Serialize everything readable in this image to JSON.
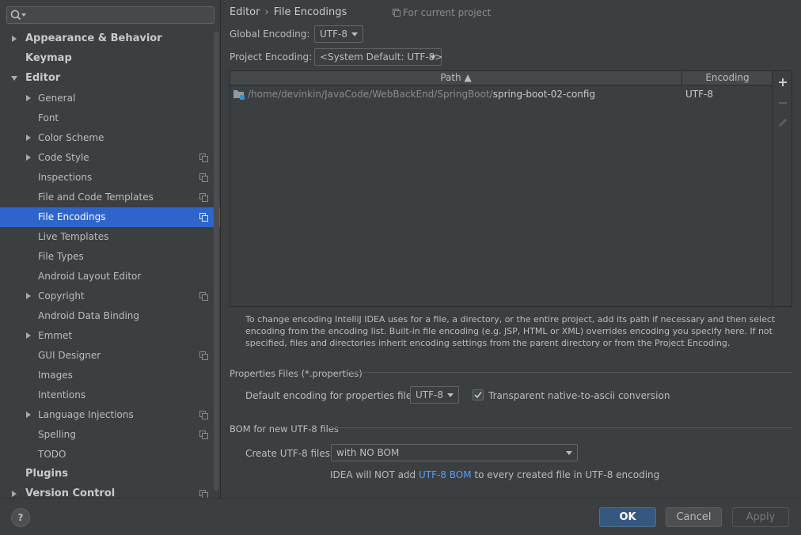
{
  "search": {
    "value": ""
  },
  "sidebar": {
    "items": [
      {
        "label": "Appearance & Behavior",
        "level": 0,
        "arrow": "right",
        "scope": false
      },
      {
        "label": "Keymap",
        "level": 0,
        "arrow": "none",
        "scope": false
      },
      {
        "label": "Editor",
        "level": 0,
        "arrow": "down",
        "scope": false
      },
      {
        "label": "General",
        "level": 1,
        "arrow": "right",
        "scope": false
      },
      {
        "label": "Font",
        "level": 1,
        "arrow": "none",
        "scope": false
      },
      {
        "label": "Color Scheme",
        "level": 1,
        "arrow": "right",
        "scope": false
      },
      {
        "label": "Code Style",
        "level": 1,
        "arrow": "right",
        "scope": true
      },
      {
        "label": "Inspections",
        "level": 1,
        "arrow": "none",
        "scope": true
      },
      {
        "label": "File and Code Templates",
        "level": 1,
        "arrow": "none",
        "scope": true
      },
      {
        "label": "File Encodings",
        "level": 1,
        "arrow": "none",
        "scope": true,
        "selected": true
      },
      {
        "label": "Live Templates",
        "level": 1,
        "arrow": "none",
        "scope": false
      },
      {
        "label": "File Types",
        "level": 1,
        "arrow": "none",
        "scope": false
      },
      {
        "label": "Android Layout Editor",
        "level": 1,
        "arrow": "none",
        "scope": false
      },
      {
        "label": "Copyright",
        "level": 1,
        "arrow": "right",
        "scope": true
      },
      {
        "label": "Android Data Binding",
        "level": 1,
        "arrow": "none",
        "scope": false
      },
      {
        "label": "Emmet",
        "level": 1,
        "arrow": "right",
        "scope": false
      },
      {
        "label": "GUI Designer",
        "level": 1,
        "arrow": "none",
        "scope": true
      },
      {
        "label": "Images",
        "level": 1,
        "arrow": "none",
        "scope": false
      },
      {
        "label": "Intentions",
        "level": 1,
        "arrow": "none",
        "scope": false
      },
      {
        "label": "Language Injections",
        "level": 1,
        "arrow": "right",
        "scope": true
      },
      {
        "label": "Spelling",
        "level": 1,
        "arrow": "none",
        "scope": true
      },
      {
        "label": "TODO",
        "level": 1,
        "arrow": "none",
        "scope": false
      },
      {
        "label": "Plugins",
        "level": 0,
        "arrow": "none",
        "scope": false
      },
      {
        "label": "Version Control",
        "level": 0,
        "arrow": "right",
        "scope": true
      }
    ]
  },
  "breadcrumb": {
    "parent": "Editor",
    "separator": "›",
    "current": "File Encodings"
  },
  "scope_note": "For current project",
  "global_encoding": {
    "label": "Global Encoding:",
    "value": "UTF-8"
  },
  "project_encoding": {
    "label": "Project Encoding:",
    "value": "<System Default: UTF-8>"
  },
  "table": {
    "col_path": "Path ▲",
    "col_encoding": "Encoding",
    "rows": [
      {
        "path_prefix": "/home/devinkin/JavaCode/WebBackEnd/SpringBoot/",
        "path_name": "spring-boot-02-config",
        "encoding": "UTF-8"
      }
    ]
  },
  "hint": "To change encoding IntelliJ IDEA uses for a file, a directory, or the entire project, add its path if necessary and then select encoding from the encoding list. Built-in file encoding (e.g. JSP, HTML or XML) overrides encoding you specify here. If not specified, files and directories inherit encoding settings from the parent directory or from the Project Encoding.",
  "properties": {
    "section_title": "Properties Files (*.properties)",
    "default_label": "Default encoding for properties files:",
    "default_value": "UTF-8",
    "ascii_label": "Transparent native-to-ascii conversion",
    "ascii_checked": true
  },
  "bom": {
    "section_title": "BOM for new UTF-8 files",
    "create_label": "Create UTF-8 files:",
    "create_value": "with NO BOM",
    "note_prefix": "IDEA will NOT add ",
    "note_link": "UTF-8 BOM",
    "note_suffix": " to every created file in UTF-8 encoding"
  },
  "buttons": {
    "help": "?",
    "ok": "OK",
    "cancel": "Cancel",
    "apply": "Apply"
  },
  "colors": {
    "accent": "#2f65ca",
    "ok_button": "#365880",
    "link": "#589df6"
  }
}
